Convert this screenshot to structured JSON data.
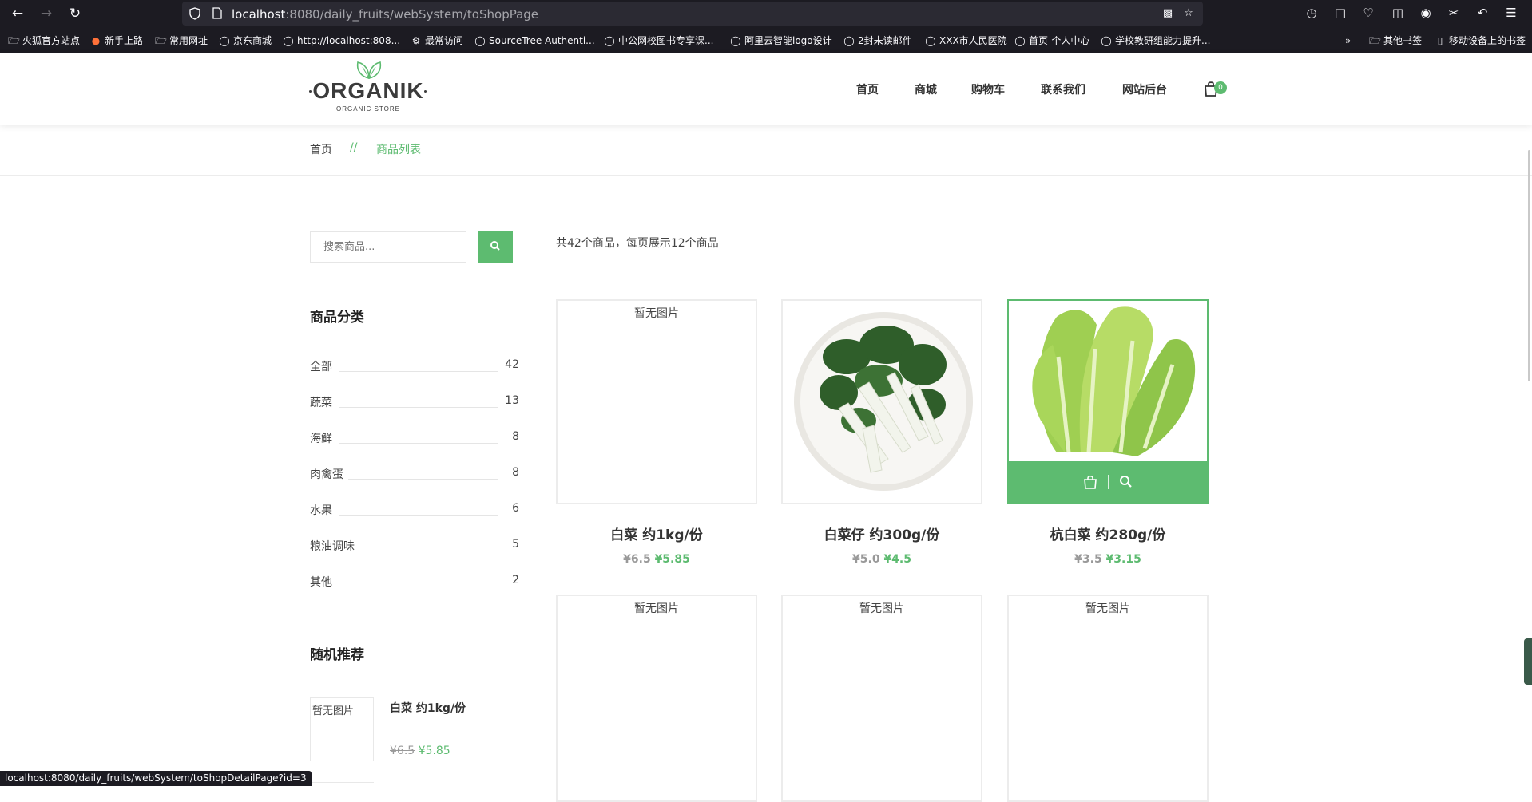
{
  "browser": {
    "url_host": "localhost",
    "url_rest": ":8080/daily_fruits/webSystem/toShopPage",
    "bookmarks": [
      {
        "label": "火狐官方站点",
        "icon": "folder-icon"
      },
      {
        "label": "新手上路",
        "icon": "firefox-icon"
      },
      {
        "label": "常用网址",
        "icon": "folder-icon"
      },
      {
        "label": "京东商城",
        "icon": "globe-icon"
      },
      {
        "label": "http://localhost:808...",
        "icon": "globe-icon"
      },
      {
        "label": "最常访问",
        "icon": "gear-icon"
      },
      {
        "label": "SourceTree Authenti...",
        "icon": "globe-icon"
      },
      {
        "label": "中公网校图书专享课...",
        "icon": "globe-icon"
      },
      {
        "label": "阿里云智能logo设计",
        "icon": "globe-icon"
      },
      {
        "label": "2封未读邮件",
        "icon": "globe-icon"
      },
      {
        "label": "XXX市人民医院",
        "icon": "globe-icon"
      },
      {
        "label": "首页-个人中心",
        "icon": "globe-icon"
      },
      {
        "label": "学校教研组能力提升...",
        "icon": "globe-icon"
      }
    ],
    "other_bookmarks": "其他书签",
    "mobile_bookmarks": "移动设备上的书签",
    "status_url": "localhost:8080/daily_fruits/webSystem/toShopDetailPage?id=3"
  },
  "logo": {
    "text": "ORGANIK",
    "subtitle": "ORGANIC STORE"
  },
  "nav": {
    "items": [
      "首页",
      "商城",
      "购物车",
      "联系我们",
      "网站后台"
    ],
    "cart_count": "0"
  },
  "breadcrumb": {
    "home": "首页",
    "separator": "//",
    "current": "商品列表"
  },
  "sidebar": {
    "search_placeholder": "搜索商品...",
    "category_title": "商品分类",
    "categories": [
      {
        "name": "全部",
        "count": "42"
      },
      {
        "name": "蔬菜",
        "count": "13"
      },
      {
        "name": "海鲜",
        "count": "8"
      },
      {
        "name": "肉禽蛋",
        "count": "8"
      },
      {
        "name": "水果",
        "count": "6"
      },
      {
        "name": "粮油调味",
        "count": "5"
      },
      {
        "name": "其他",
        "count": "2"
      }
    ],
    "recommend_title": "随机推荐",
    "recommend": {
      "no_image": "暂无图片",
      "title": "白菜 约1kg/份",
      "old_price": "¥6.5",
      "new_price": "¥5.85"
    }
  },
  "products": {
    "summary": "共42个商品，每页展示12个商品",
    "no_image_text": "暂无图片",
    "items": [
      {
        "title": "白菜 约1kg/份",
        "old_price": "¥6.5",
        "new_price": "¥5.85",
        "image": "none"
      },
      {
        "title": "白菜仔 约300g/份",
        "old_price": "¥5.0",
        "new_price": "¥4.5",
        "image": "bok-choy-plate"
      },
      {
        "title": "杭白菜 约280g/份",
        "old_price": "¥3.5",
        "new_price": "¥3.15",
        "image": "lettuce"
      }
    ]
  },
  "colors": {
    "accent": "#5dbb70",
    "browser_bg": "#1c1b22",
    "urlbar_bg": "#2b2a33"
  }
}
